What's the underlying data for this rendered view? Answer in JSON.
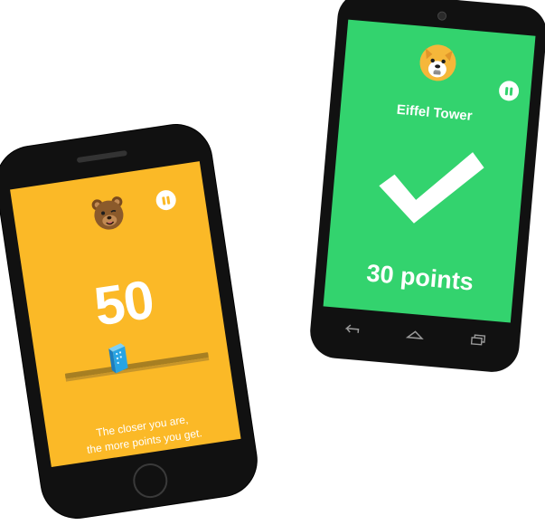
{
  "left_phone": {
    "score": "50",
    "hint_line1": "The closer you are,",
    "hint_line2": "the more points you get.",
    "screen_color": "#FBB927",
    "slider_position": 0.38,
    "avatar": "bear-avatar-icon",
    "pause_icon": "pause-icon"
  },
  "right_phone": {
    "title": "Eiffel Tower",
    "points": "30 points",
    "screen_color": "#33D36E",
    "avatar": "dog-avatar-icon",
    "result_icon": "checkmark-icon",
    "pause_icon": "pause-icon",
    "nav": [
      "back-icon",
      "home-icon",
      "recents-icon"
    ]
  }
}
